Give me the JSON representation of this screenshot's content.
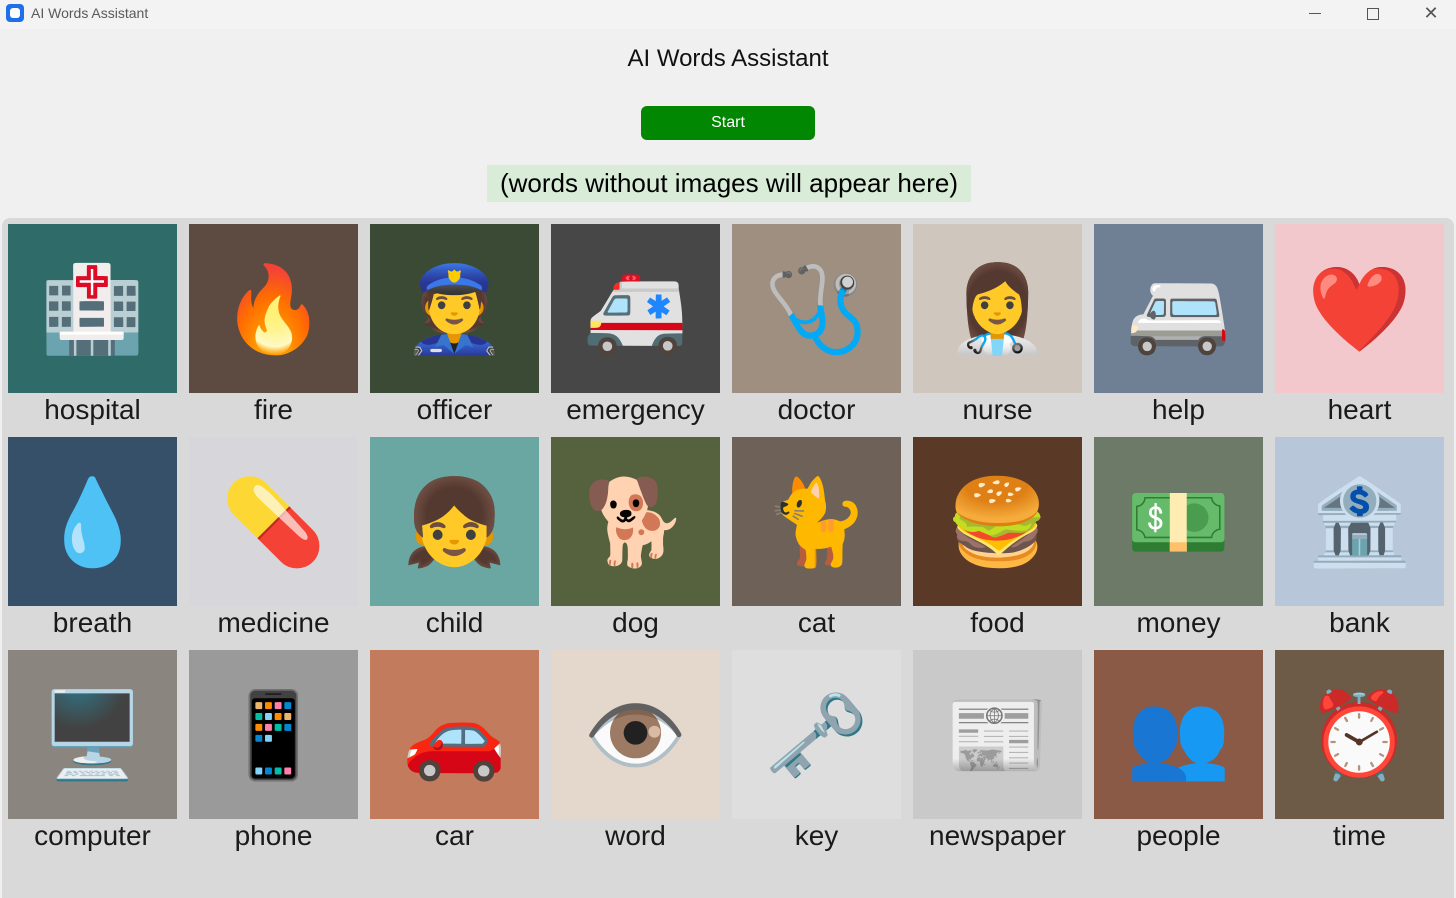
{
  "window": {
    "title": "AI Words Assistant",
    "icon": "app-icon"
  },
  "main": {
    "heading": "AI Words Assistant",
    "start_label": "Start",
    "missing_words_text": "(words without images will appear here)",
    "start_color": "#028702"
  },
  "words": [
    {
      "label": "hospital",
      "icon": "hospital-room",
      "glyph": "🏥",
      "bg": "#2f6b68"
    },
    {
      "label": "fire",
      "icon": "flames",
      "glyph": "🔥",
      "bg": "#5d4a40"
    },
    {
      "label": "officer",
      "icon": "police-officer",
      "glyph": "👮",
      "bg": "#3a4a34"
    },
    {
      "label": "emergency",
      "icon": "ambulance",
      "glyph": "🚑",
      "bg": "#474747"
    },
    {
      "label": "doctor",
      "icon": "doctor",
      "glyph": "🩺",
      "bg": "#9e8f80"
    },
    {
      "label": "nurse",
      "icon": "nurse",
      "glyph": "👩‍⚕️",
      "bg": "#cfc6bd"
    },
    {
      "label": "help",
      "icon": "ambulance-van",
      "glyph": "🚐",
      "bg": "#6f7f94"
    },
    {
      "label": "heart",
      "icon": "cartoon-heart",
      "glyph": "❤️",
      "bg": "#f3c8cd"
    },
    {
      "label": "breath",
      "icon": "face-water",
      "glyph": "💧",
      "bg": "#36506a"
    },
    {
      "label": "medicine",
      "icon": "pills",
      "glyph": "💊",
      "bg": "#d7d7db"
    },
    {
      "label": "child",
      "icon": "cartoon-child",
      "glyph": "👧",
      "bg": "#6aa6a2"
    },
    {
      "label": "dog",
      "icon": "dog",
      "glyph": "🐕",
      "bg": "#56623d"
    },
    {
      "label": "cat",
      "icon": "cat",
      "glyph": "🐈",
      "bg": "#6e6258"
    },
    {
      "label": "food",
      "icon": "burgers",
      "glyph": "🍔",
      "bg": "#5a3a26"
    },
    {
      "label": "money",
      "icon": "cash-stacks",
      "glyph": "💵",
      "bg": "#6d7a68"
    },
    {
      "label": "bank",
      "icon": "bank-building",
      "glyph": "🏦",
      "bg": "#b7c6d9"
    },
    {
      "label": "computer",
      "icon": "desktop-computer",
      "glyph": "🖥️",
      "bg": "#8b857f"
    },
    {
      "label": "phone",
      "icon": "smartphone",
      "glyph": "📱",
      "bg": "#9a9a9a"
    },
    {
      "label": "car",
      "icon": "classic-car",
      "glyph": "🚗",
      "bg": "#c27b5d"
    },
    {
      "label": "word",
      "icon": "eye",
      "glyph": "👁️",
      "bg": "#e4d7cc"
    },
    {
      "label": "key",
      "icon": "key",
      "glyph": "🗝️",
      "bg": "#dedede"
    },
    {
      "label": "newspaper",
      "icon": "newspapers",
      "glyph": "📰",
      "bg": "#c9c9c9"
    },
    {
      "label": "people",
      "icon": "crowd",
      "glyph": "👥",
      "bg": "#8a5a46"
    },
    {
      "label": "time",
      "icon": "alarm-clock",
      "glyph": "⏰",
      "bg": "#6d5a47"
    }
  ]
}
